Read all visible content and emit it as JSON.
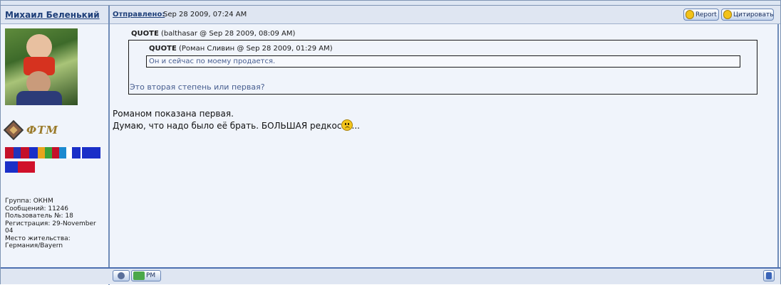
{
  "post": {
    "author": "Михаил Беленький",
    "posted_label": "Отправлено:",
    "posted_date": "Sep 28 2009, 07:24 AM",
    "buttons": {
      "report": "Report",
      "quote": "Цитировать",
      "pm": "PM"
    }
  },
  "user_info": {
    "rank_text": "ФТМ",
    "lines": [
      "Группа: ОКНМ",
      "Сообщений: 11246",
      "Пользователь №: 18",
      "Регистрация: 29-November",
      "04",
      "Место жительства:",
      "Германия/Bayern"
    ]
  },
  "quote_outer": {
    "title_label": "QUOTE",
    "title_meta": "(balthasar @ Sep 28 2009, 08:09 AM)",
    "text": "Это вторая степень или первая?"
  },
  "quote_inner": {
    "title_label": "QUOTE",
    "title_meta": "(Роман Сливин @ Sep 28 2009, 01:29 AM)",
    "text": "Он и сейчас по моему продается."
  },
  "body": {
    "line1": "Романом показана первая.",
    "line2": "Думаю, что надо было её брать. БОЛЬШАЯ редкость..."
  },
  "icons": [
    "report-icon",
    "quote-icon",
    "smiley-sad-icon",
    "profile-icon",
    "pm-icon",
    "scroll-top-icon",
    "rank-icon"
  ],
  "colors": {
    "link": "#1e3f79",
    "quote_text": "#465d8f",
    "header_bg": "#dfe6f2",
    "border": "#6f8cb8"
  }
}
